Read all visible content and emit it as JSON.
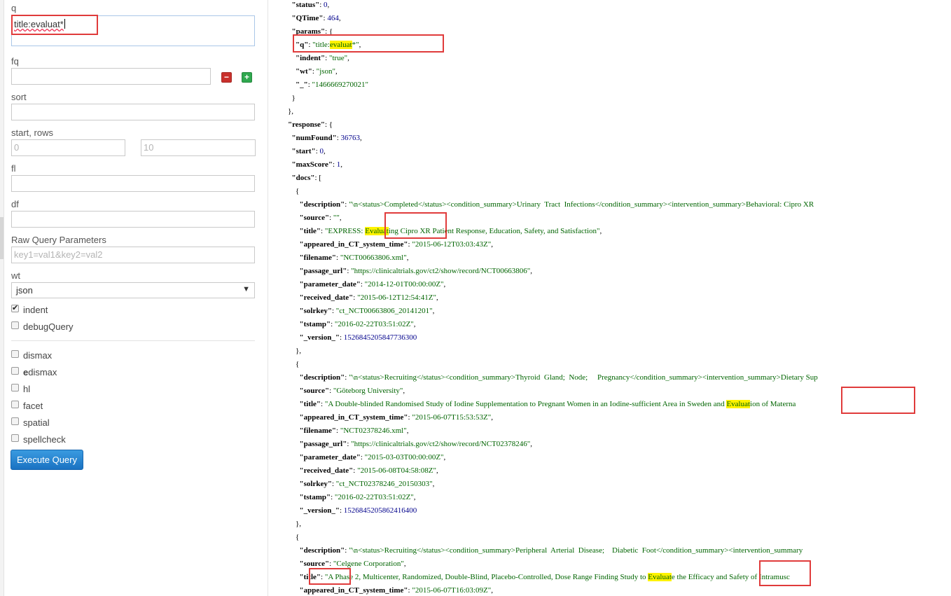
{
  "form": {
    "q_label": "q",
    "q_value": "title:evaluat*",
    "fq_label": "fq",
    "fq_value": "",
    "fq_remove_icon": "minus",
    "fq_add_icon": "plus",
    "sort_label": "sort",
    "start_rows_label": "start, rows",
    "start_placeholder": "0",
    "rows_placeholder": "10",
    "fl_label": "fl",
    "df_label": "df",
    "raw_label": "Raw Query Parameters",
    "raw_placeholder": "key1=val1&key2=val2",
    "wt_label": "wt",
    "wt_value": "json",
    "indent_label": "indent",
    "indent_checked": true,
    "debug_label": "debugQuery",
    "dismax_label": "dismax",
    "edismax_bold": "e",
    "edismax_rest": "dismax",
    "hl_label": "hl",
    "facet_label": "facet",
    "spatial_label": "spatial",
    "spellcheck_label": "spellcheck",
    "execute_label": "Execute Query"
  },
  "lines": [
    {
      "t": [
        [
          "  ",
          ""
        ],
        [
          "\"status\"",
          "k"
        ],
        [
          ": ",
          ""
        ],
        [
          "0",
          "n"
        ],
        [
          ",",
          ""
        ]
      ]
    },
    {
      "t": [
        [
          "  ",
          ""
        ],
        [
          "\"QTime\"",
          "k"
        ],
        [
          ": ",
          ""
        ],
        [
          "464",
          "n"
        ],
        [
          ",",
          ""
        ]
      ]
    },
    {
      "t": [
        [
          "  ",
          ""
        ],
        [
          "\"params\"",
          "k"
        ],
        [
          ": {",
          ""
        ]
      ]
    },
    {
      "t": [
        [
          "    ",
          ""
        ],
        [
          "\"q\"",
          "k"
        ],
        [
          ": ",
          ""
        ],
        [
          "\"title:",
          "s"
        ],
        [
          "evaluat",
          "s hl"
        ],
        [
          "*\"",
          "s"
        ],
        [
          ",",
          ""
        ]
      ]
    },
    {
      "t": [
        [
          "    ",
          ""
        ],
        [
          "\"indent\"",
          "k"
        ],
        [
          ": ",
          ""
        ],
        [
          "\"true\"",
          "s"
        ],
        [
          ",",
          ""
        ]
      ]
    },
    {
      "t": [
        [
          "    ",
          ""
        ],
        [
          "\"wt\"",
          "k"
        ],
        [
          ": ",
          ""
        ],
        [
          "\"json\"",
          "s"
        ],
        [
          ",",
          ""
        ]
      ]
    },
    {
      "t": [
        [
          "    ",
          ""
        ],
        [
          "\"_\"",
          "k"
        ],
        [
          ": ",
          ""
        ],
        [
          "\"1466669270021\"",
          "s"
        ]
      ]
    },
    {
      "t": [
        [
          "  }",
          ""
        ]
      ]
    },
    {
      "t": [
        [
          "},",
          ""
        ]
      ]
    },
    {
      "t": [
        [
          "\"response\"",
          "k"
        ],
        [
          ": {",
          ""
        ]
      ]
    },
    {
      "t": [
        [
          "  ",
          ""
        ],
        [
          "\"numFound\"",
          "k"
        ],
        [
          ": ",
          ""
        ],
        [
          "36763",
          "n"
        ],
        [
          ",",
          ""
        ]
      ]
    },
    {
      "t": [
        [
          "  ",
          ""
        ],
        [
          "\"start\"",
          "k"
        ],
        [
          ": ",
          ""
        ],
        [
          "0",
          "n"
        ],
        [
          ",",
          ""
        ]
      ]
    },
    {
      "t": [
        [
          "  ",
          ""
        ],
        [
          "\"maxScore\"",
          "k"
        ],
        [
          ": ",
          ""
        ],
        [
          "1",
          "n"
        ],
        [
          ",",
          ""
        ]
      ]
    },
    {
      "t": [
        [
          "  ",
          ""
        ],
        [
          "\"docs\"",
          "k"
        ],
        [
          ": [",
          ""
        ]
      ]
    },
    {
      "t": [
        [
          "    {",
          ""
        ]
      ]
    },
    {
      "t": [
        [
          "      ",
          ""
        ],
        [
          "\"description\"",
          "k"
        ],
        [
          ": ",
          ""
        ],
        [
          "\"\\n<status>Completed</status><condition_summary>Urinary  Tract  Infections</condition_summary><intervention_summary>Behavioral: Cipro XR",
          "s"
        ]
      ]
    },
    {
      "t": [
        [
          "      ",
          ""
        ],
        [
          "\"source\"",
          "k"
        ],
        [
          ": ",
          ""
        ],
        [
          "\"\"",
          "s"
        ],
        [
          ",",
          ""
        ]
      ]
    },
    {
      "t": [
        [
          "      ",
          ""
        ],
        [
          "\"title\"",
          "k"
        ],
        [
          ": ",
          ""
        ],
        [
          "\"EXPRESS: ",
          "s"
        ],
        [
          "Evaluat",
          "s hl"
        ],
        [
          "ing Cipro XR Patient Response, Education, Safety, and Satisfaction\"",
          "s"
        ],
        [
          ",",
          ""
        ]
      ]
    },
    {
      "t": [
        [
          "      ",
          ""
        ],
        [
          "\"appeared_in_CT_system_time\"",
          "k"
        ],
        [
          ": ",
          ""
        ],
        [
          "\"2015-06-12T03:03:43Z\"",
          "s"
        ],
        [
          ",",
          ""
        ]
      ]
    },
    {
      "t": [
        [
          "      ",
          ""
        ],
        [
          "\"filename\"",
          "k"
        ],
        [
          ": ",
          ""
        ],
        [
          "\"NCT00663806.xml\"",
          "s"
        ],
        [
          ",",
          ""
        ]
      ]
    },
    {
      "t": [
        [
          "      ",
          ""
        ],
        [
          "\"passage_url\"",
          "k"
        ],
        [
          ": ",
          ""
        ],
        [
          "\"https://clinicaltrials.gov/ct2/show/record/NCT00663806\"",
          "s"
        ],
        [
          ",",
          ""
        ]
      ]
    },
    {
      "t": [
        [
          "      ",
          ""
        ],
        [
          "\"parameter_date\"",
          "k"
        ],
        [
          ": ",
          ""
        ],
        [
          "\"2014-12-01T00:00:00Z\"",
          "s"
        ],
        [
          ",",
          ""
        ]
      ]
    },
    {
      "t": [
        [
          "      ",
          ""
        ],
        [
          "\"received_date\"",
          "k"
        ],
        [
          ": ",
          ""
        ],
        [
          "\"2015-06-12T12:54:41Z\"",
          "s"
        ],
        [
          ",",
          ""
        ]
      ]
    },
    {
      "t": [
        [
          "      ",
          ""
        ],
        [
          "\"solrkey\"",
          "k"
        ],
        [
          ": ",
          ""
        ],
        [
          "\"ct_NCT00663806_20141201\"",
          "s"
        ],
        [
          ",",
          ""
        ]
      ]
    },
    {
      "t": [
        [
          "      ",
          ""
        ],
        [
          "\"tstamp\"",
          "k"
        ],
        [
          ": ",
          ""
        ],
        [
          "\"2016-02-22T03:51:02Z\"",
          "s"
        ],
        [
          ",",
          ""
        ]
      ]
    },
    {
      "t": [
        [
          "      ",
          ""
        ],
        [
          "\"_version_\"",
          "k"
        ],
        [
          ": ",
          ""
        ],
        [
          "1526845205847736300",
          "n"
        ]
      ]
    },
    {
      "t": [
        [
          "    },",
          ""
        ]
      ]
    },
    {
      "t": [
        [
          "    {",
          ""
        ]
      ]
    },
    {
      "t": [
        [
          "      ",
          ""
        ],
        [
          "\"description\"",
          "k"
        ],
        [
          ": ",
          ""
        ],
        [
          "\"\\n<status>Recruiting</status><condition_summary>Thyroid  Gland;  Node;     Pregnancy</condition_summary><intervention_summary>Dietary Sup",
          "s"
        ]
      ]
    },
    {
      "t": [
        [
          "      ",
          ""
        ],
        [
          "\"source\"",
          "k"
        ],
        [
          ": ",
          ""
        ],
        [
          "\"Göteborg University\"",
          "s"
        ],
        [
          ",",
          ""
        ]
      ]
    },
    {
      "t": [
        [
          "      ",
          ""
        ],
        [
          "\"title\"",
          "k"
        ],
        [
          ": ",
          ""
        ],
        [
          "\"A Double-blinded Randomised Study of Iodine Supplementation to Pregnant Women in an Iodine-sufficient Area in Sweden and ",
          "s"
        ],
        [
          "Evaluat",
          "s hl"
        ],
        [
          "ion of Materna",
          "s"
        ]
      ]
    },
    {
      "t": [
        [
          "      ",
          ""
        ],
        [
          "\"appeared_in_CT_system_time\"",
          "k"
        ],
        [
          ": ",
          ""
        ],
        [
          "\"2015-06-07T15:53:53Z\"",
          "s"
        ],
        [
          ",",
          ""
        ]
      ]
    },
    {
      "t": [
        [
          "      ",
          ""
        ],
        [
          "\"filename\"",
          "k"
        ],
        [
          ": ",
          ""
        ],
        [
          "\"NCT02378246.xml\"",
          "s"
        ],
        [
          ",",
          ""
        ]
      ]
    },
    {
      "t": [
        [
          "      ",
          ""
        ],
        [
          "\"passage_url\"",
          "k"
        ],
        [
          ": ",
          ""
        ],
        [
          "\"https://clinicaltrials.gov/ct2/show/record/NCT02378246\"",
          "s"
        ],
        [
          ",",
          ""
        ]
      ]
    },
    {
      "t": [
        [
          "      ",
          ""
        ],
        [
          "\"parameter_date\"",
          "k"
        ],
        [
          ": ",
          ""
        ],
        [
          "\"2015-03-03T00:00:00Z\"",
          "s"
        ],
        [
          ",",
          ""
        ]
      ]
    },
    {
      "t": [
        [
          "      ",
          ""
        ],
        [
          "\"received_date\"",
          "k"
        ],
        [
          ": ",
          ""
        ],
        [
          "\"2015-06-08T04:58:08Z\"",
          "s"
        ],
        [
          ",",
          ""
        ]
      ]
    },
    {
      "t": [
        [
          "      ",
          ""
        ],
        [
          "\"solrkey\"",
          "k"
        ],
        [
          ": ",
          ""
        ],
        [
          "\"ct_NCT02378246_20150303\"",
          "s"
        ],
        [
          ",",
          ""
        ]
      ]
    },
    {
      "t": [
        [
          "      ",
          ""
        ],
        [
          "\"tstamp\"",
          "k"
        ],
        [
          ": ",
          ""
        ],
        [
          "\"2016-02-22T03:51:02Z\"",
          "s"
        ],
        [
          ",",
          ""
        ]
      ]
    },
    {
      "t": [
        [
          "      ",
          ""
        ],
        [
          "\"_version_\"",
          "k"
        ],
        [
          ": ",
          ""
        ],
        [
          "1526845205862416400",
          "n"
        ]
      ]
    },
    {
      "t": [
        [
          "    },",
          ""
        ]
      ]
    },
    {
      "t": [
        [
          "    {",
          ""
        ]
      ]
    },
    {
      "t": [
        [
          "      ",
          ""
        ],
        [
          "\"description\"",
          "k"
        ],
        [
          ": ",
          ""
        ],
        [
          "\"\\n<status>Recruiting</status><condition_summary>Peripheral  Arterial  Disease;    Diabetic  Foot</condition_summary><intervention_summary",
          "s"
        ]
      ]
    },
    {
      "t": [
        [
          "      ",
          ""
        ],
        [
          "\"source\"",
          "k"
        ],
        [
          ": ",
          ""
        ],
        [
          "\"Celgene Corporation\"",
          "s"
        ],
        [
          ",",
          ""
        ]
      ]
    },
    {
      "t": [
        [
          "      ",
          ""
        ],
        [
          "\"title\"",
          "k"
        ],
        [
          ": ",
          ""
        ],
        [
          "\"A Phase 2, Multicenter, Randomized, Double-Blind, Placebo-Controlled, Dose Range Finding Study to ",
          "s"
        ],
        [
          "Evaluat",
          "s hl"
        ],
        [
          "e the Efficacy and Safety of Intramusc",
          "s"
        ]
      ]
    },
    {
      "t": [
        [
          "      ",
          ""
        ],
        [
          "\"appeared_in_CT_system_time\"",
          "k"
        ],
        [
          ": ",
          ""
        ],
        [
          "\"2015-06-07T16:03:09Z\"",
          "s"
        ],
        [
          ",",
          ""
        ]
      ]
    }
  ]
}
